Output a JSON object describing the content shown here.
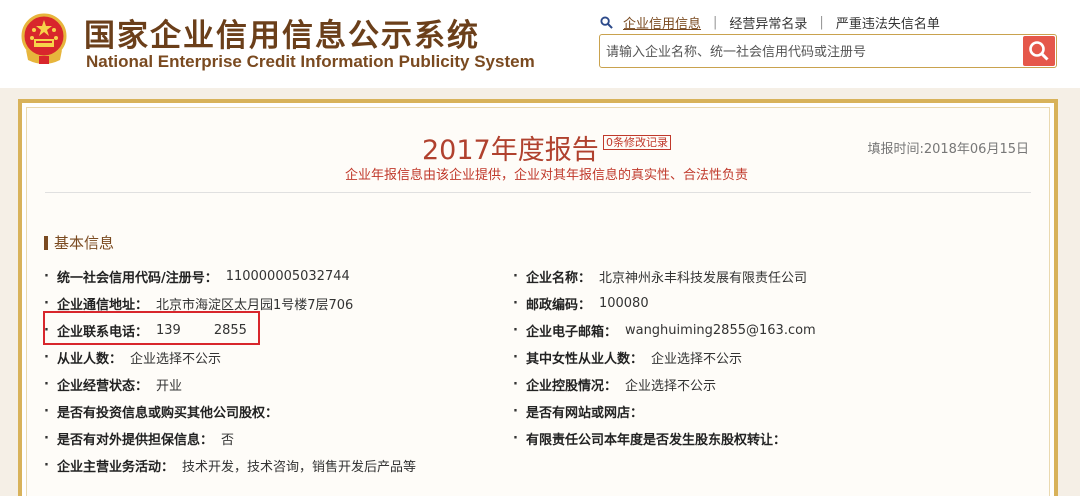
{
  "header": {
    "title_cn": "国家企业信用信息公示系统",
    "title_en": "National Enterprise Credit Information Publicity System",
    "emblem_icon": "national-emblem-icon",
    "nav": [
      {
        "label": "企业信用信息",
        "active": true
      },
      {
        "label": "经营异常名录",
        "active": false
      },
      {
        "label": "严重违法失信名单",
        "active": false
      }
    ],
    "nav_separator": "|",
    "search": {
      "placeholder": "请输入企业名称、统一社会信用代码或注册号",
      "value": "",
      "button_icon": "search-icon"
    }
  },
  "report": {
    "title": "2017年度报告",
    "revision_link": "0条修改记录",
    "filing_time": "填报时间:2018年06月15日",
    "subtitle": "企业年报信息由该企业提供，企业对其年报信息的真实性、合法性负责",
    "section_title": "基本信息",
    "bullet": "·",
    "left_fields": [
      {
        "label": "统一社会信用代码/注册号：",
        "value": "110000005032744"
      },
      {
        "label": "企业通信地址：",
        "value": "北京市海淀区太月园1号楼7层706"
      },
      {
        "label": "企业联系电话：",
        "value": "139        2855",
        "highlighted": true
      },
      {
        "label": "从业人数：",
        "value": "企业选择不公示"
      },
      {
        "label": "企业经营状态：",
        "value": "开业"
      },
      {
        "label": "是否有投资信息或购买其他公司股权：",
        "value": ""
      },
      {
        "label": "是否有对外提供担保信息：",
        "value": "否"
      },
      {
        "label": "企业主营业务活动：",
        "value": "技术开发，技术咨询，销售开发后产品等"
      }
    ],
    "right_fields": [
      {
        "label": "企业名称：",
        "value": "北京神州永丰科技发展有限责任公司"
      },
      {
        "label": "邮政编码：",
        "value": "100080"
      },
      {
        "label": "企业电子邮箱：",
        "value": "wanghuiming2855@163.com"
      },
      {
        "label": "其中女性从业人数：",
        "value": "企业选择不公示"
      },
      {
        "label": "企业控股情况：",
        "value": "企业选择不公示"
      },
      {
        "label": "是否有网站或网店：",
        "value": ""
      },
      {
        "label": "有限责任公司本年度是否发生股东股权转让：",
        "value": ""
      }
    ]
  },
  "colors": {
    "brand_brown": "#6b3f1a",
    "gold_border": "#d8b25a",
    "report_title_red": "#b0412e",
    "search_button": "#e5574a",
    "highlight_red": "#d8262c"
  }
}
